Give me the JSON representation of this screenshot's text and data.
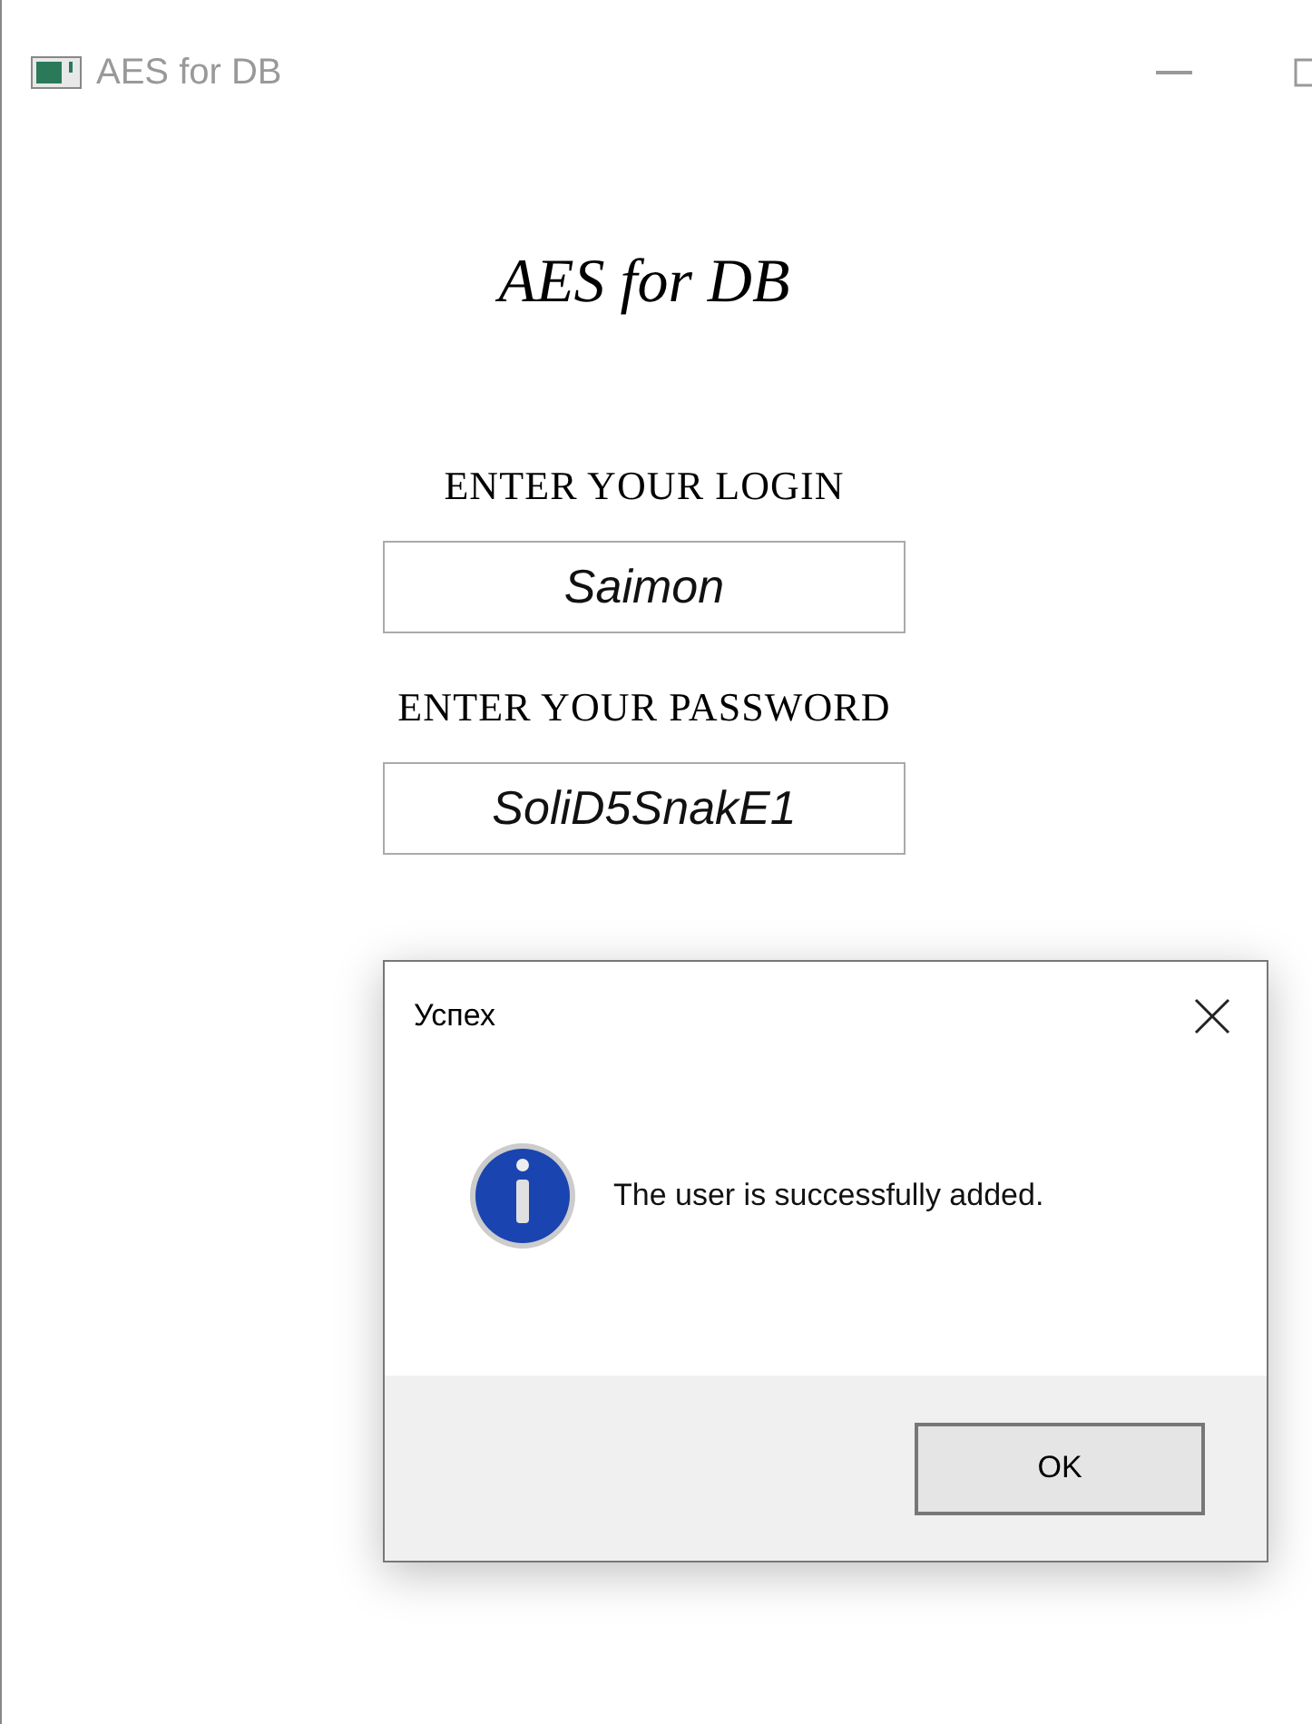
{
  "window": {
    "title": "AES for DB"
  },
  "heading": "AES for DB",
  "fields": [
    {
      "label": "ENTER YOUR LOGIN",
      "value": "Saimon"
    },
    {
      "label": "ENTER YOUR PASSWORD",
      "value": "SoliD5SnakE1"
    }
  ],
  "dialog": {
    "title": "Успех",
    "message": "The user is successfully added.",
    "button": "OK"
  }
}
